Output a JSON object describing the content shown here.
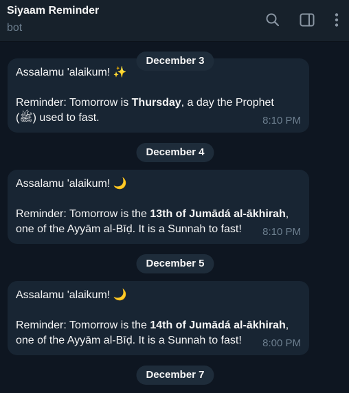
{
  "header": {
    "title": "Siyaam Reminder",
    "subtitle": "bot",
    "icons": [
      "search-icon",
      "sidebar-toggle-icon",
      "more-vertical-icon"
    ]
  },
  "messages": [
    {
      "date": "December 3",
      "greeting": "Assalamu 'alaikum! ✨",
      "line1_pre": "Reminder: Tomorrow is ",
      "line1_bold": "Thursday",
      "line1_post": ", a day the Prophet",
      "line2": "(ﷺ) used to fast.",
      "time": "8:10 PM"
    },
    {
      "date": "December 4",
      "greeting": "Assalamu 'alaikum! 🌙",
      "line1_pre": "Reminder: Tomorrow is the ",
      "line1_bold": "13th of Jumādá al-ākhirah",
      "line1_post": ",",
      "line2": "one of the Ayyām al-Bīḍ. It is a Sunnah to fast!",
      "time": "8:10 PM"
    },
    {
      "date": "December 5",
      "greeting": "Assalamu 'alaikum! 🌙",
      "line1_pre": "Reminder: Tomorrow is the ",
      "line1_bold": "14th of Jumādá al-ākhirah",
      "line1_post": ",",
      "line2": "one of the Ayyām al-Bīḍ. It is a Sunnah to fast!",
      "time": "8:00 PM"
    }
  ],
  "trailing_date": "December 7",
  "colors": {
    "background": "#0e1621",
    "header": "#17212b",
    "bubble": "#182533",
    "date_pill": "#1e2c3a",
    "muted": "#6d7f8f"
  }
}
